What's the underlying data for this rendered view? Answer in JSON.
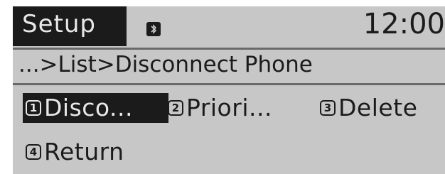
{
  "header": {
    "title": "Setup",
    "status_icon": "bluetooth-icon",
    "clock": "12:00"
  },
  "breadcrumb": "...>List>Disconnect Phone",
  "menu": {
    "items": [
      {
        "number": "1",
        "label": "Disco...",
        "selected": true
      },
      {
        "number": "2",
        "label": "Priori...",
        "selected": false
      },
      {
        "number": "3",
        "label": "Delete",
        "selected": false
      },
      {
        "number": "4",
        "label": "Return",
        "selected": false
      }
    ]
  },
  "colors": {
    "screen_background": "#c7c7c7",
    "highlight": "#1b1b1b",
    "highlight_text": "#e8e8e8",
    "divider": "#6a6a6a"
  }
}
